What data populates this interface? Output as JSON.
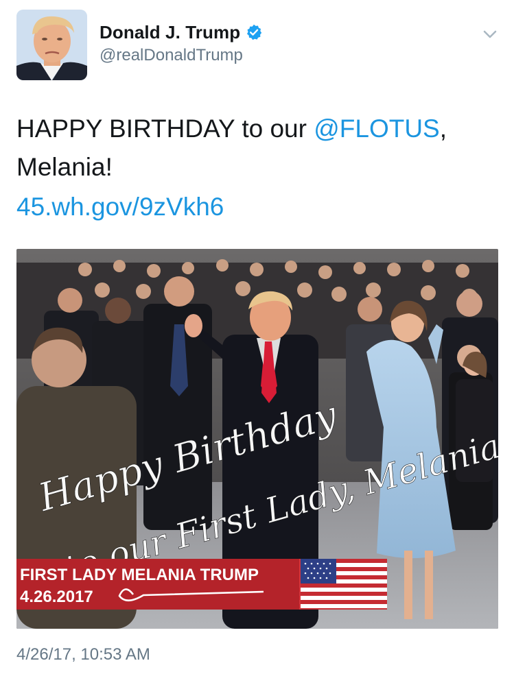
{
  "header": {
    "display_name": "Donald J. Trump",
    "handle": "@realDonaldTrump"
  },
  "tweet": {
    "text_before": "HAPPY BIRTHDAY to our ",
    "mention": "@FLOTUS",
    "text_after": ",",
    "line2": "Melania!",
    "link": "45.wh.gov/9zVkh6"
  },
  "media": {
    "script_line1": "Happy Birthday",
    "script_line2": "to our First Lady, Melania!",
    "banner_title": "FIRST LADY MELANIA TRUMP",
    "banner_date": "4.26.2017"
  },
  "timestamp": "4/26/17, 10:53 AM",
  "colors": {
    "link": "#1b95e0",
    "verified": "#1da1f2",
    "muted": "#657786",
    "banner_red": "#b4232a",
    "dress_blue": "#a8c8e4"
  },
  "icons": {
    "verified": "verified-badge-icon",
    "caret": "chevron-down-icon",
    "flag": "us-flag-icon"
  }
}
